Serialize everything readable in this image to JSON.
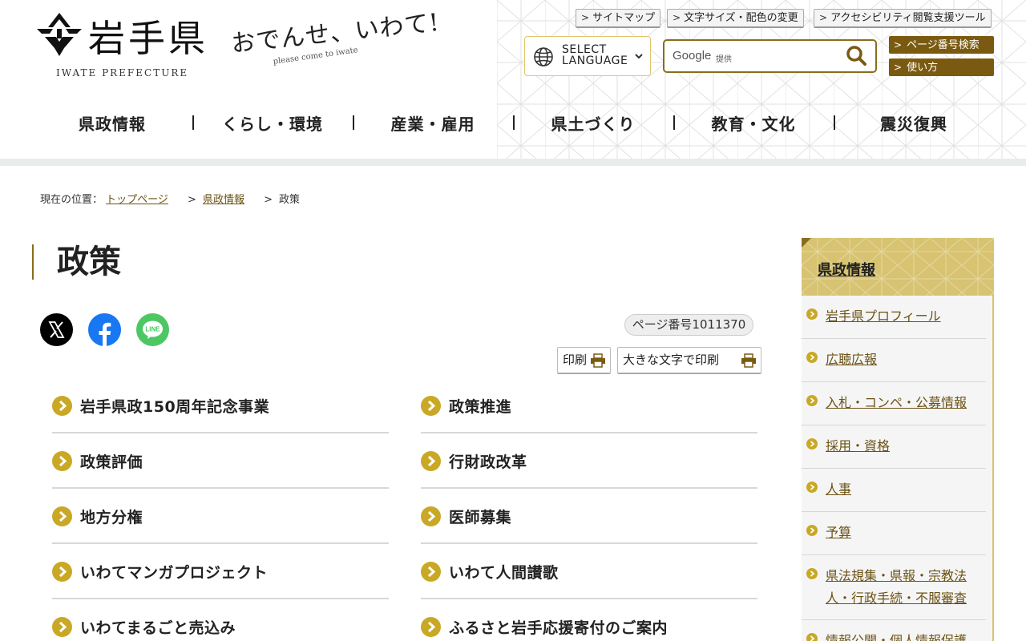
{
  "header": {
    "logo_title": "岩手県",
    "logo_sub": "IWATE PREFECTURE",
    "slogan_main": "おでんせ、いわて!",
    "slogan_sub": "please come to iwate",
    "utility_links": [
      "サイトマップ",
      "文字サイズ・配色の変更",
      "アクセシビリティ閲覧支援ツール"
    ],
    "language": {
      "line1": "SELECT",
      "line2": "LANGUAGE"
    },
    "search": {
      "brand": "Google",
      "provided": "提供",
      "placeholder": "",
      "value": ""
    },
    "gold_buttons": [
      "ページ番号検索",
      "使い方"
    ],
    "global_nav": [
      "県政情報",
      "くらし・環境",
      "産業・雇用",
      "県土づくり",
      "教育・文化",
      "震災復興"
    ]
  },
  "breadcrumb": {
    "prefix": "現在の位置：",
    "links": [
      "トップページ",
      "県政情報"
    ],
    "current": "政策",
    "separator": ">"
  },
  "main": {
    "title": "政策",
    "social": [
      "x-icon",
      "facebook-icon",
      "line-icon"
    ],
    "page_number": "ページ番号1011370",
    "print_label": "印刷",
    "print_large_label": "大きな文字で印刷",
    "links": [
      "岩手県政150周年記念事業",
      "政策推進",
      "政策評価",
      "行財政改革",
      "地方分権",
      "医師募集",
      "いわてマンガプロジェクト",
      "いわて人間讃歌",
      "いわてまるごと売込み",
      "ふるさと岩手応援寄付のご案内"
    ]
  },
  "sidebar": {
    "heading": "県政情報",
    "items": [
      "岩手県プロフィール",
      "広聴広報",
      "入札・コンペ・公募情報",
      "採用・資格",
      "人事",
      "予算",
      "県法規集・県報・宗教法人・行政手続・不服審査",
      "情報公開・個人情報保護"
    ]
  },
  "colors": {
    "gold_dark": "#7a5a10",
    "gold_light": "#d7c371",
    "arrow_gold": "#c9a826",
    "link_brown": "#6b5214"
  }
}
